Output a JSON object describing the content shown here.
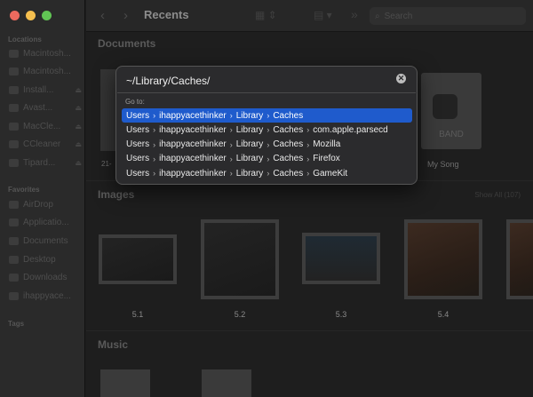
{
  "window": {
    "title": "Recents"
  },
  "toolbar": {
    "search_placeholder": "Search",
    "forward_chevrons": "»"
  },
  "sidebar": {
    "locations_header": "Locations",
    "locations": [
      {
        "label": "Macintosh..."
      },
      {
        "label": "Macintosh..."
      },
      {
        "label": "Install..."
      },
      {
        "label": "Avast..."
      },
      {
        "label": "MacCle..."
      },
      {
        "label": "CCleaner"
      },
      {
        "label": "Tipard..."
      }
    ],
    "favorites_header": "Favorites",
    "favorites": [
      {
        "label": "AirDrop"
      },
      {
        "label": "Applicatio..."
      },
      {
        "label": "Documents"
      },
      {
        "label": "Desktop"
      },
      {
        "label": "Downloads"
      },
      {
        "label": "ihappyace..."
      }
    ],
    "tags_header": "Tags"
  },
  "sections": {
    "documents": {
      "title": "Documents",
      "partial_label": "21-",
      "band_label": "BAND",
      "my_song": "My Song"
    },
    "images": {
      "title": "Images",
      "show_all": "Show All (107)",
      "items": [
        {
          "label": "5.1"
        },
        {
          "label": "5.2"
        },
        {
          "label": "5.3"
        },
        {
          "label": "5.4"
        }
      ]
    },
    "music": {
      "title": "Music"
    }
  },
  "goto_dialog": {
    "path_value": "~/Library/Caches/",
    "go_to_label": "Go to:",
    "suggestions": [
      {
        "segments": [
          "Users",
          "ihappyacethinker",
          "Library",
          "Caches"
        ],
        "selected": true
      },
      {
        "segments": [
          "Users",
          "ihappyacethinker",
          "Library",
          "Caches",
          "com.apple.parsecd"
        ],
        "selected": false
      },
      {
        "segments": [
          "Users",
          "ihappyacethinker",
          "Library",
          "Caches",
          "Mozilla"
        ],
        "selected": false
      },
      {
        "segments": [
          "Users",
          "ihappyacethinker",
          "Library",
          "Caches",
          "Firefox"
        ],
        "selected": false
      },
      {
        "segments": [
          "Users",
          "ihappyacethinker",
          "Library",
          "Caches",
          "GameKit"
        ],
        "selected": false
      }
    ]
  },
  "colors": {
    "selection": "#1f5bcc",
    "dialog_bg": "#2b2b2d"
  }
}
